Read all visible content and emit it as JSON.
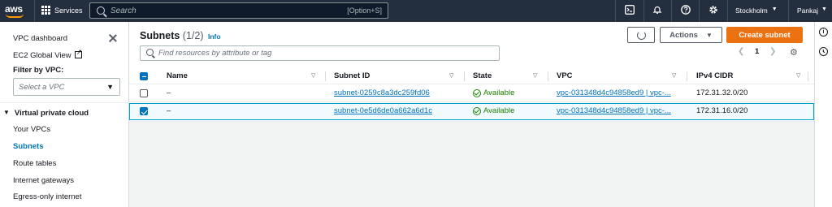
{
  "topbar": {
    "logo": "aws",
    "services_label": "Services",
    "search_placeholder": "Search",
    "search_shortcut": "[Option+S]",
    "icons": [
      "cloudshell-icon",
      "bell-icon",
      "help-icon",
      "gear-icon"
    ],
    "region_label": "Stockholm",
    "user_label": "Pankaj"
  },
  "sidebar": {
    "vpc_dashboard": "VPC dashboard",
    "ec2_global_view": "EC2 Global View",
    "filter_label": "Filter by VPC:",
    "select_placeholder": "Select a VPC",
    "section_title": "Virtual private cloud",
    "items": [
      {
        "label": "Your VPCs"
      },
      {
        "label": "Subnets"
      },
      {
        "label": "Route tables"
      },
      {
        "label": "Internet gateways"
      },
      {
        "label": "Egress-only internet"
      }
    ]
  },
  "main": {
    "title": "Subnets",
    "count": "(1/2)",
    "info_label": "Info",
    "actions_label": "Actions",
    "create_label": "Create subnet",
    "find_placeholder": "Find resources by attribute or tag",
    "page_number": "1",
    "columns": [
      "Name",
      "Subnet ID",
      "State",
      "VPC",
      "IPv4 CIDR"
    ],
    "rows": [
      {
        "name": "–",
        "subnet_id": "subnet-0259c8a3dc259fd06",
        "state": "Available",
        "vpc": "vpc-031348d4c94858ed9 | vpc-...",
        "cidr": "172.31.32.0/20",
        "selected": false
      },
      {
        "name": "–",
        "subnet_id": "subnet-0e5d6de0a662a6d1c",
        "state": "Available",
        "vpc": "vpc-031348d4c94858ed9 | vpc-...",
        "cidr": "172.31.16.0/20",
        "selected": true
      }
    ]
  },
  "colors": {
    "topbar_bg": "#232f3e",
    "accent_orange": "#ec7211",
    "link_blue": "#0073bb",
    "status_green": "#1d8102"
  }
}
